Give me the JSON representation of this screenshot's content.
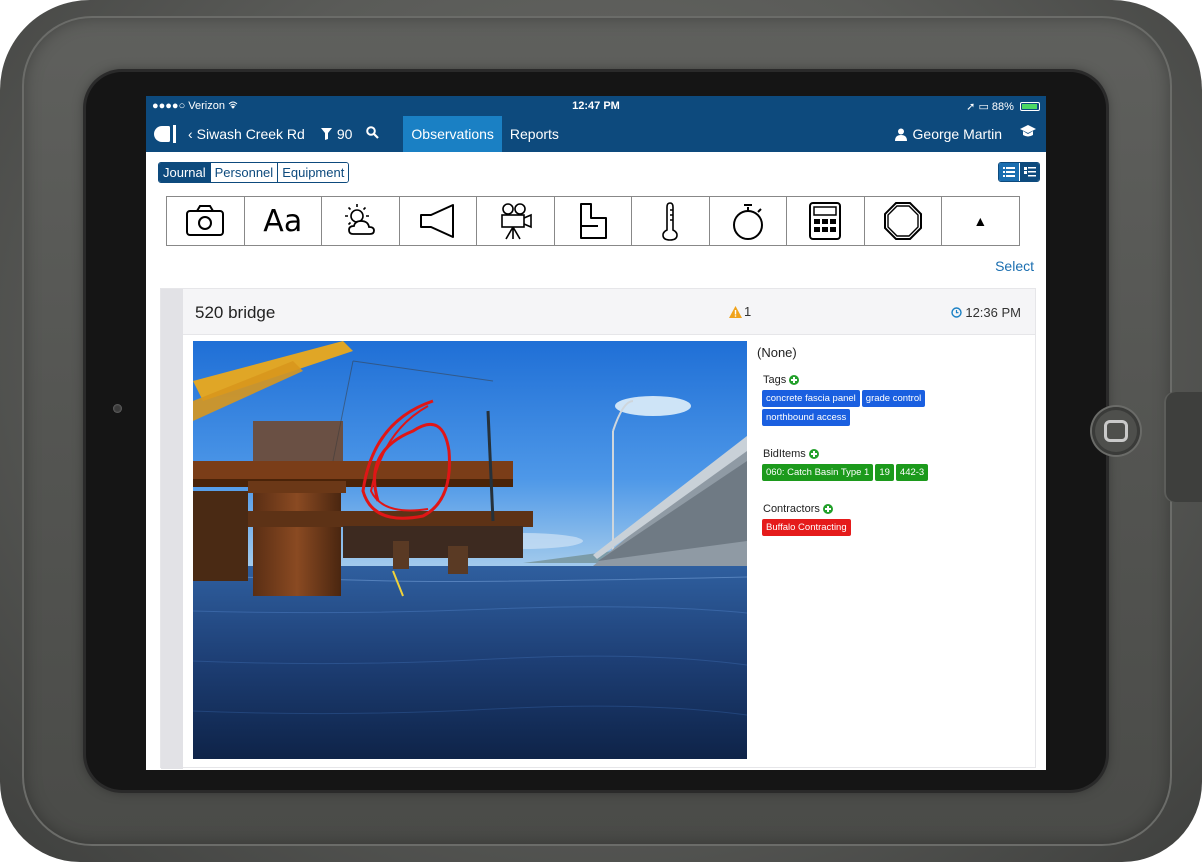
{
  "status_bar": {
    "carrier": "●●●●○ Verizon",
    "time": "12:47 PM",
    "battery": "88%"
  },
  "nav": {
    "back_label": "Siwash Creek Rd",
    "filter_count": "90",
    "tabs": [
      {
        "label": "Observations",
        "active": true
      },
      {
        "label": "Reports",
        "active": false
      }
    ],
    "user_name": "George Martin",
    "icons": [
      "app-logo-icon",
      "chevron-left-icon",
      "filter-icon",
      "search-icon",
      "user-icon",
      "graduation-cap-icon"
    ]
  },
  "segments": [
    {
      "label": "Journal",
      "active": true
    },
    {
      "label": "Personnel",
      "active": false
    },
    {
      "label": "Equipment",
      "active": false
    }
  ],
  "view_toggle": [
    "list-icon",
    "list-detail-icon"
  ],
  "entry_types": [
    {
      "icon": "camera-icon"
    },
    {
      "icon": "text-icon",
      "label": "Aa"
    },
    {
      "icon": "weather-icon"
    },
    {
      "icon": "megaphone-icon"
    },
    {
      "icon": "video-camera-icon"
    },
    {
      "icon": "inspection-icon"
    },
    {
      "icon": "thermometer-icon"
    },
    {
      "icon": "stopwatch-icon"
    },
    {
      "icon": "calculator-icon"
    },
    {
      "icon": "octagon-icon"
    },
    {
      "icon": "triangle-up-icon",
      "label": "▲"
    }
  ],
  "select_label": "Select",
  "observation": {
    "title": "520 bridge",
    "warning_count": "1",
    "time": "12:36 PM",
    "description": "(None)",
    "tags_label": "Tags",
    "tags": [
      "concrete fascia panel",
      "grade control",
      "northbound access"
    ],
    "biditems_label": "BidItems",
    "biditems": [
      "060: Catch Basin Type 1",
      "19",
      "442-3"
    ],
    "contractors_label": "Contractors",
    "contractors": [
      "Buffalo Contracting"
    ],
    "colors": {
      "tag": "#1a5fe0",
      "biditem": "#1c9a1c",
      "contractor": "#e51b1b"
    }
  },
  "theme": {
    "navbar": "#0d4a7d",
    "active_tab": "#1a80c4",
    "link": "#1a6eb0"
  }
}
